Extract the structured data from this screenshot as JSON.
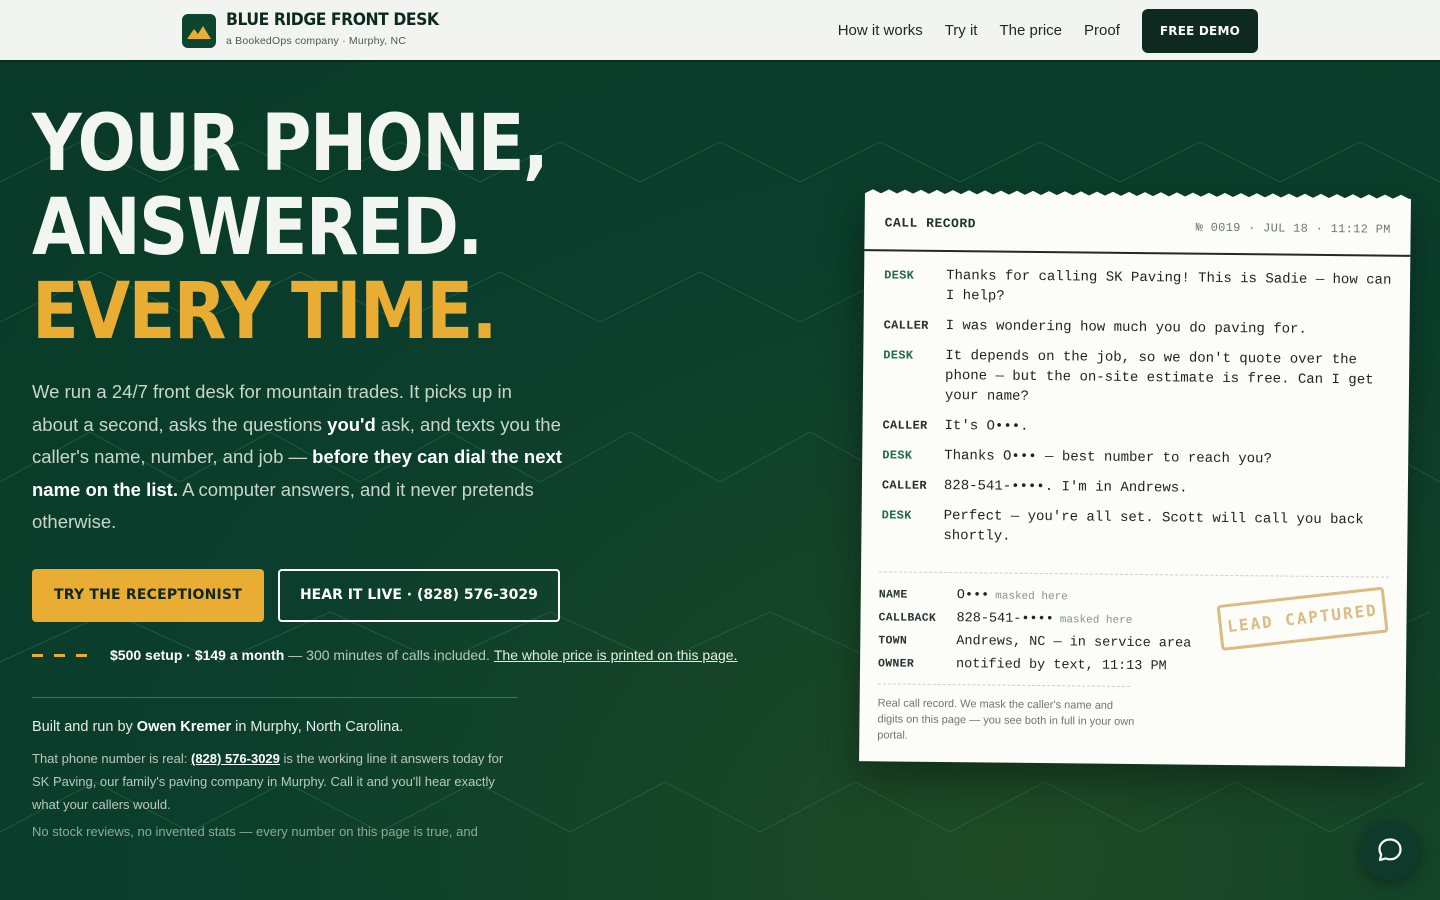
{
  "header": {
    "brand_name": "BLUE RIDGE FRONT DESK",
    "brand_sub": "a BookedOps company · Murphy, NC",
    "nav": [
      "How it works",
      "Try it",
      "The price",
      "Proof"
    ],
    "cta": "FREE DEMO"
  },
  "hero": {
    "line1": "YOUR PHONE,",
    "line2": "ANSWERED.",
    "line3": "EVERY TIME.",
    "lede": {
      "p1": "We run a 24/7 front desk for mountain trades. It picks up in about a second, asks the questions ",
      "b1": "you'd",
      "p2": " ask, and texts you the caller's name, number, and job — ",
      "b2": "before they can dial the next name on the list.",
      "p3": " A computer answers, and it never pretends otherwise."
    },
    "primary_cta": "TRY THE RECEPTIONIST",
    "secondary_cta": "HEAR IT LIVE · (828) 576-3029",
    "price": {
      "bold": "$500 setup · $149 a month",
      "rest": "— 300 minutes of calls included.",
      "link": "The whole price is printed on this page."
    },
    "builder": {
      "pre": "Built and run by ",
      "name": "Owen Kremer",
      "post": " in Murphy, North Carolina."
    },
    "proof": {
      "pre": "That phone number is real: ",
      "phone": "(828) 576-3029",
      "post": " is the working line it answers today for SK Paving, our family's paving company in Murphy. Call it and you'll hear exactly what your callers would."
    },
    "fine": "No stock reviews, no invented stats — every number on this page is true, and"
  },
  "call_record": {
    "title": "CALL RECORD",
    "meta": "№ 0019 · JUL 18 · 11:12 PM",
    "transcript": [
      {
        "who": "DESK",
        "text": "Thanks for calling SK Paving! This is Sadie — how can I help?"
      },
      {
        "who": "CALLER",
        "text": "I was wondering how much you do paving for."
      },
      {
        "who": "DESK",
        "text": "It depends on the job, so we don't quote over the phone — but the on-site estimate is free. Can I get your name?"
      },
      {
        "who": "CALLER",
        "text": "It's O•••."
      },
      {
        "who": "DESK",
        "text": "Thanks O••• — best number to reach you?"
      },
      {
        "who": "CALLER",
        "text": "828-541-••••. I'm in Andrews."
      },
      {
        "who": "DESK",
        "text": "Perfect — you're all set. Scott will call you back shortly."
      }
    ],
    "fields": [
      {
        "key": "NAME",
        "value": "O•••",
        "note": "masked here"
      },
      {
        "key": "CALLBACK",
        "value": "828-541-••••",
        "note": "masked here"
      },
      {
        "key": "TOWN",
        "value": "Andrews, NC — in service area",
        "note": ""
      },
      {
        "key": "OWNER",
        "value": "notified by text, 11:13 PM",
        "note": ""
      }
    ],
    "stamp": "LEAD CAPTURED",
    "note": "Real call record. We mask the caller's name and digits on this page — you see both in full in your own portal."
  },
  "colors": {
    "accent": "#e9ad34",
    "hero_bg": "#0a3d2c",
    "desk_label": "#1f6b4c"
  },
  "icons": {
    "brand": "mountain-icon",
    "chat": "chat-bubble-icon"
  }
}
